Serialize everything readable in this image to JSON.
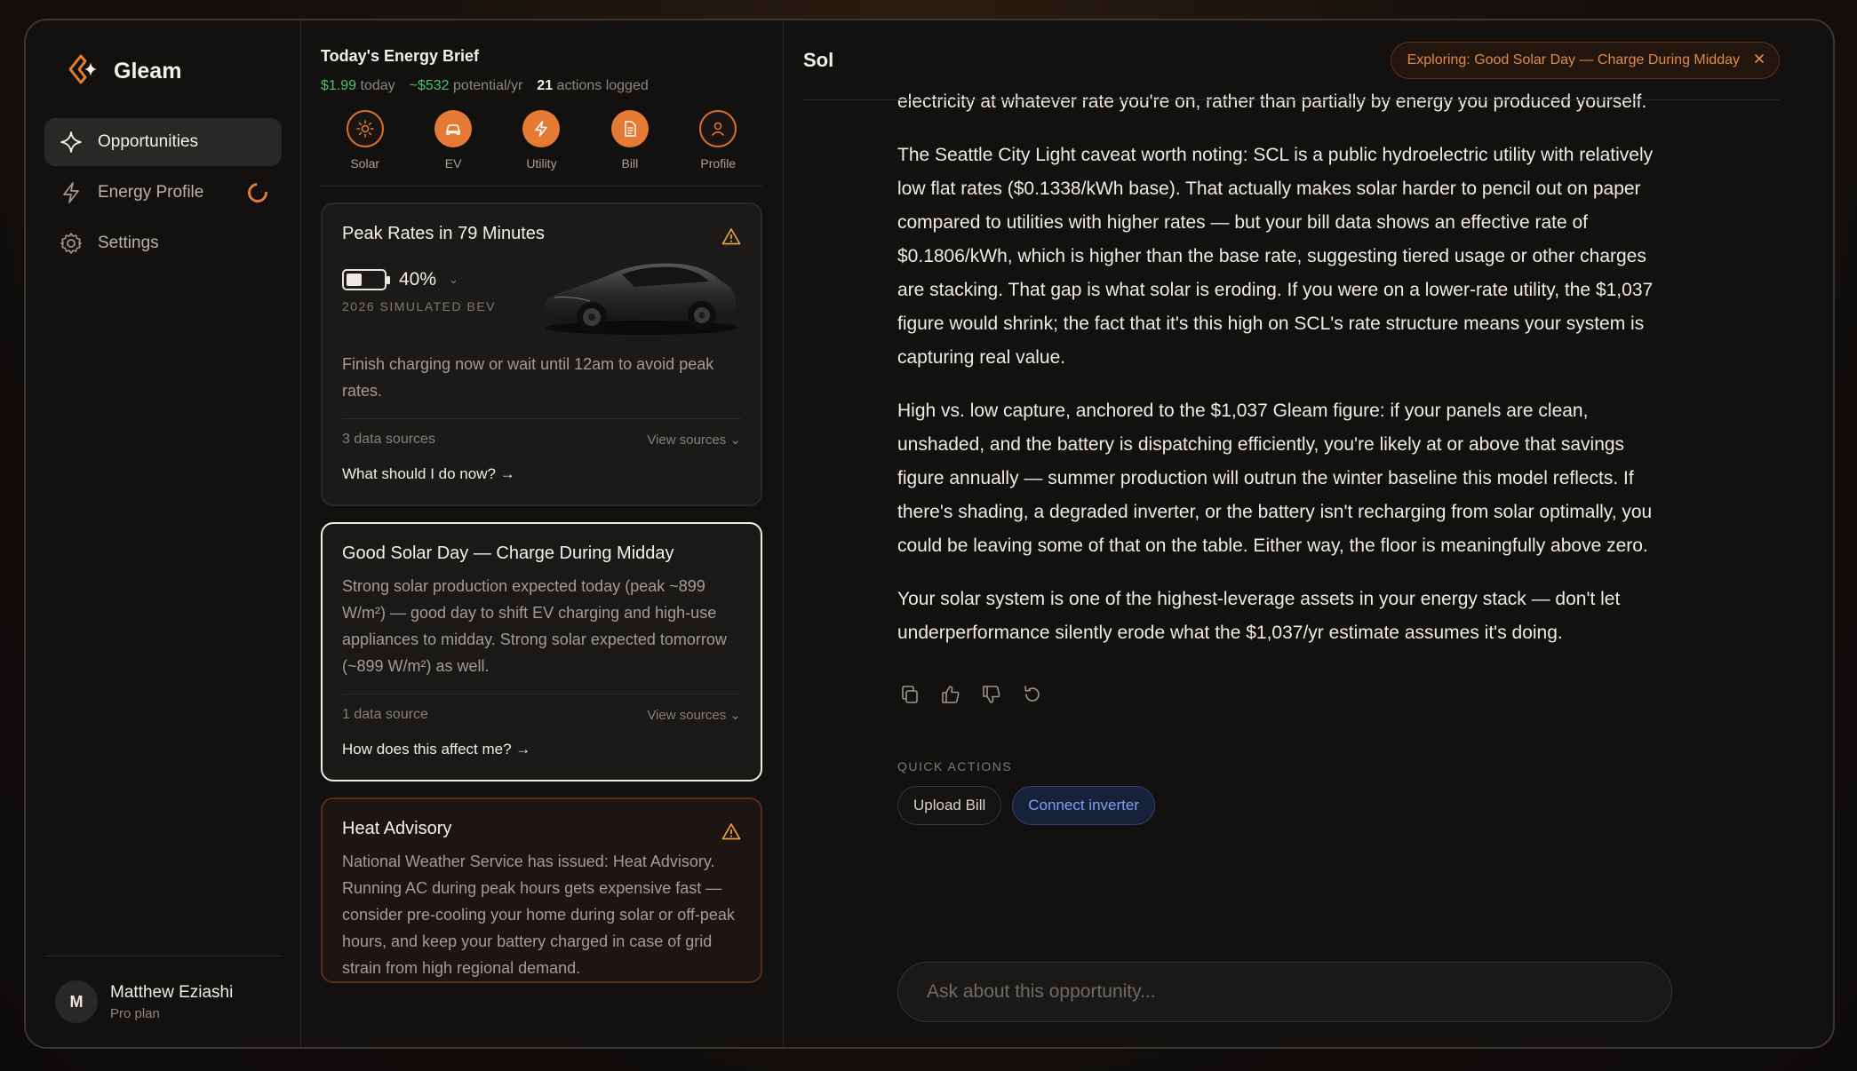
{
  "app": {
    "name": "Gleam"
  },
  "sidebar": {
    "items": [
      {
        "label": "Opportunities",
        "icon": "sparkle-icon",
        "active": true
      },
      {
        "label": "Energy Profile",
        "icon": "bolt-icon",
        "loading": true
      },
      {
        "label": "Settings",
        "icon": "gear-icon"
      }
    ],
    "user": {
      "initial": "M",
      "name": "Matthew Eziashi",
      "plan": "Pro plan"
    }
  },
  "brief": {
    "title": "Today's Energy Brief",
    "today_value": "$1.99",
    "today_label": "today",
    "potential_value": "~$532",
    "potential_label": "potential/yr",
    "actions_value": "21",
    "actions_label": "actions logged",
    "categories": [
      {
        "label": "Solar",
        "icon": "sun-icon"
      },
      {
        "label": "EV",
        "icon": "car-icon"
      },
      {
        "label": "Utility",
        "icon": "bolt-icon"
      },
      {
        "label": "Bill",
        "icon": "document-icon"
      },
      {
        "label": "Profile",
        "icon": "user-icon"
      }
    ]
  },
  "cards": {
    "peak": {
      "title": "Peak Rates in 79 Minutes",
      "battery_pct": "40%",
      "battery_level": 0.4,
      "vehicle": "2026 SIMULATED BEV",
      "text": "Finish charging now or wait until 12am to avoid peak rates.",
      "sources": "3 data sources",
      "view_sources": "View sources",
      "cta": "What should I do now? →"
    },
    "solar": {
      "title": "Good Solar Day — Charge During Midday",
      "text": "Strong solar production expected today (peak ~899 W/m²) — good day to shift EV charging and high-use appliances to midday. Strong solar expected tomorrow (~899 W/m²) as well.",
      "sources": "1 data source",
      "view_sources": "View sources",
      "cta": "How does this affect me? →"
    },
    "heat": {
      "title": "Heat Advisory",
      "text": "National Weather Service has issued: Heat Advisory. Running AC during peak hours gets expensive fast — consider pre-cooling your home during solar or off-peak hours, and keep your battery charged in case of grid strain from high regional demand."
    }
  },
  "chat": {
    "title": "Sol",
    "exploring": "Exploring: Good Solar Day — Charge During Midday",
    "paragraphs": [
      "electricity at whatever rate you're on, rather than partially by energy you produced yourself.",
      "The Seattle City Light caveat worth noting: SCL is a public hydroelectric utility with relatively low flat rates ($0.1338/kWh base). That actually makes solar harder to pencil out on paper compared to utilities with higher rates — but your bill data shows an effective rate of $0.1806/kWh, which is higher than the base rate, suggesting tiered usage or other charges are stacking. That gap is what solar is eroding. If you were on a lower-rate utility, the $1,037 figure would shrink; the fact that it's this high on SCL's rate structure means your system is capturing real value.",
      "High vs. low capture, anchored to the $1,037 Gleam figure: if your panels are clean, unshaded, and the battery is dispatching efficiently, you're likely at or above that savings figure annually — summer production will outrun the winter baseline this model reflects. If there's shading, a degraded inverter, or the battery isn't recharging from solar optimally, you could be leaving some of that on the table. Either way, the floor is meaningfully above zero.",
      "Your solar system is one of the highest-leverage assets in your energy stack — don't let underperformance silently erode what the $1,037/yr estimate assumes it's doing."
    ],
    "quick_actions_label": "QUICK ACTIONS",
    "quick_actions": [
      "Upload Bill",
      "Connect inverter"
    ],
    "input_placeholder": "Ask about this opportunity..."
  },
  "colors": {
    "accent": "#e57a34",
    "positive": "#4fc06a",
    "link_blue": "#7ea0ee"
  }
}
